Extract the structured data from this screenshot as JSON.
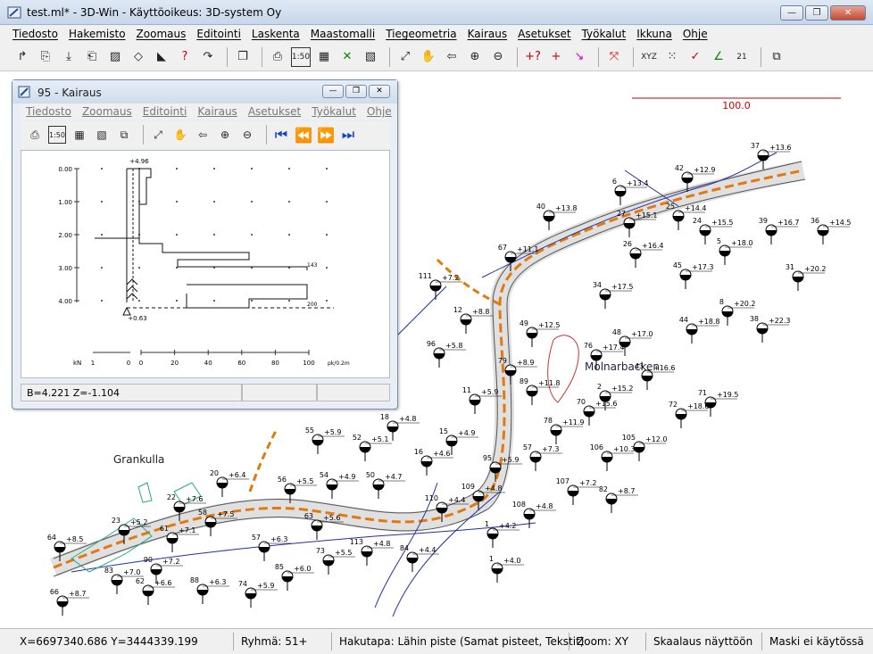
{
  "window": {
    "title": "test.ml* - 3D-Win - Käyttöoikeus: 3D-system Oy",
    "minimize": "—",
    "maximize": "❐",
    "close": "✕"
  },
  "menu": [
    "Tiedosto",
    "Hakemisto",
    "Zoomaus",
    "Editointi",
    "Laskenta",
    "Maastomalli",
    "Tiegeometria",
    "Kairaus",
    "Asetukset",
    "Työkalut",
    "Ikkuna",
    "Ohje"
  ],
  "toolbar_icons": [
    "open-icon",
    "open2-icon",
    "save-icon",
    "saveas-icon",
    "hatch-icon",
    "erase-icon",
    "draw-icon",
    "help-icon",
    "undo-icon",
    "copy-icon",
    "print-icon",
    "scale-icon",
    "grid-icon",
    "layer-icon",
    "hatch2-icon",
    "fit-icon",
    "pan-icon",
    "back-icon",
    "zoom-in-icon",
    "zoom-out-icon",
    "query-icon",
    "add-icon",
    "snap-icon",
    "polyline-icon",
    "xyz-icon",
    "points-icon",
    "check-icon",
    "angle-icon",
    "number-icon",
    "window-icon"
  ],
  "map": {
    "scale_label": "100.0",
    "place_names": [
      "Grankulla",
      "Molnarbacken"
    ],
    "points": [
      {
        "id": "37",
        "val": "+13.6"
      },
      {
        "id": "42",
        "val": "+12.9"
      },
      {
        "id": "6",
        "val": "+13.4"
      },
      {
        "id": "40",
        "val": "+13.8"
      },
      {
        "id": "27",
        "val": "+15.1"
      },
      {
        "id": "25",
        "val": "+14.4"
      },
      {
        "id": "24",
        "val": "+15.5"
      },
      {
        "id": "39",
        "val": "+16.7"
      },
      {
        "id": "36",
        "val": "+14.5"
      },
      {
        "id": "67",
        "val": "+11.1"
      },
      {
        "id": "26",
        "val": "+16.4"
      },
      {
        "id": "5",
        "val": "+18.0"
      },
      {
        "id": "45",
        "val": "+17.3"
      },
      {
        "id": "31",
        "val": "+20.2"
      },
      {
        "id": "111",
        "val": "+7.2"
      },
      {
        "id": "34",
        "val": "+17.5"
      },
      {
        "id": "12",
        "val": "+8.8"
      },
      {
        "id": "8",
        "val": "+20.2"
      },
      {
        "id": "49",
        "val": "+12.5"
      },
      {
        "id": "48",
        "val": "+17.0"
      },
      {
        "id": "44",
        "val": "+18.8"
      },
      {
        "id": "38",
        "val": "+22.3"
      },
      {
        "id": "96",
        "val": "+5.8"
      },
      {
        "id": "76",
        "val": "+17.4"
      },
      {
        "id": "79",
        "val": "+8.9"
      },
      {
        "id": "43",
        "val": "+16.6"
      },
      {
        "id": "89",
        "val": "+11.8"
      },
      {
        "id": "11",
        "val": "+5.9"
      },
      {
        "id": "2",
        "val": "+15.2"
      },
      {
        "id": "70",
        "val": "+15.6"
      },
      {
        "id": "71",
        "val": "+19.5"
      },
      {
        "id": "72",
        "val": "+18.6"
      },
      {
        "id": "18",
        "val": "+4.8"
      },
      {
        "id": "78",
        "val": "+11.9"
      },
      {
        "id": "55",
        "val": "+5.9"
      },
      {
        "id": "52",
        "val": "+5.1"
      },
      {
        "id": "15",
        "val": "+4.9"
      },
      {
        "id": "105",
        "val": "+12.0"
      },
      {
        "id": "106",
        "val": "+10.3"
      },
      {
        "id": "16",
        "val": "+4.6"
      },
      {
        "id": "95",
        "val": "+5.9"
      },
      {
        "id": "57",
        "val": "+7.3"
      },
      {
        "id": "20",
        "val": "+6.4"
      },
      {
        "id": "56",
        "val": "+5.5"
      },
      {
        "id": "54",
        "val": "+4.9"
      },
      {
        "id": "50",
        "val": "+4.7"
      },
      {
        "id": "107",
        "val": "+7.2"
      },
      {
        "id": "82",
        "val": "+8.7"
      },
      {
        "id": "22",
        "val": "+7.6"
      },
      {
        "id": "58",
        "val": "+7.5"
      },
      {
        "id": "23",
        "val": "+5.2"
      },
      {
        "id": "109",
        "val": "+4.8"
      },
      {
        "id": "110",
        "val": "+4.4"
      },
      {
        "id": "108",
        "val": "+4.8"
      },
      {
        "id": "63",
        "val": "+5.6"
      },
      {
        "id": "1",
        "val": "+4.2"
      },
      {
        "id": "61",
        "val": "+7.1"
      },
      {
        "id": "64",
        "val": "+8.5"
      },
      {
        "id": "57b",
        "val": "+6.3"
      },
      {
        "id": "113",
        "val": "+4.8"
      },
      {
        "id": "73",
        "val": "+5.5"
      },
      {
        "id": "84",
        "val": "+4.4"
      },
      {
        "id": "1b",
        "val": "+4.0"
      },
      {
        "id": "90",
        "val": "+7.2"
      },
      {
        "id": "83",
        "val": "+7.0"
      },
      {
        "id": "62",
        "val": "+6.6"
      },
      {
        "id": "85",
        "val": "+6.0"
      },
      {
        "id": "88",
        "val": "+6.3"
      },
      {
        "id": "74",
        "val": "+5.9"
      },
      {
        "id": "66",
        "val": "+8.7"
      }
    ]
  },
  "child": {
    "title": "95 - Kairaus",
    "menu": [
      "Tiedosto",
      "Zoomaus",
      "Editointi",
      "Kairaus",
      "Asetukset",
      "Työkalut",
      "Ohje"
    ],
    "plot": {
      "top_label": "+4.96",
      "bottom_label": "+0.63",
      "depth_ticks": [
        "0.00",
        "1.00",
        "2.00",
        "3.00",
        "4.00"
      ],
      "axis_left": [
        "kN",
        "1",
        "0"
      ],
      "axis_bottom": [
        "0",
        "20",
        "40",
        "60",
        "80",
        "100"
      ],
      "axis_unit": "pk/0.2m",
      "right_labels": [
        "143",
        "200"
      ]
    },
    "status": [
      "B=4.221  Z=-1.104",
      "",
      ""
    ]
  },
  "status": [
    "X=6697340.686  Y=3444339.199",
    "Ryhmä: 51+",
    "Hakutapa: Lähin piste (Samat pisteet, Tekstit)",
    "Zoom: XY",
    "Skaalaus näyttöön",
    "Maski ei käytössä"
  ]
}
